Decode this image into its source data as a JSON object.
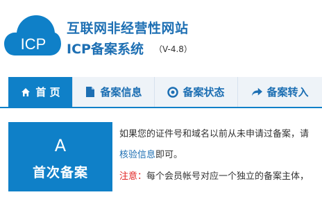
{
  "header": {
    "logo_text": "ICP",
    "title_line1": "互联网非经营性网站",
    "title_line2": "ICP备案系统",
    "version": "（V-4.8）"
  },
  "nav": {
    "tabs": [
      {
        "label": "首 页",
        "icon": "home-icon",
        "active": true
      },
      {
        "label": "备案信息",
        "icon": "document-icon",
        "active": false
      },
      {
        "label": "备案状态",
        "icon": "status-icon",
        "active": false
      },
      {
        "label": "备案转入",
        "icon": "forward-arrow-icon",
        "active": false
      }
    ]
  },
  "main": {
    "box": {
      "letter": "A",
      "label": "首次备案"
    },
    "para1": "如果您的证件号和域名以前从未申请过备案，请",
    "para2_link": "核验信息",
    "para2_rest": "即可。",
    "para3_warn": "注意：",
    "para3_rest": "每个会员帐号对应一个独立的备案主体，"
  },
  "colors": {
    "brand": "#0f80c8",
    "title": "#1d6fb3",
    "warning": "#e02020"
  }
}
